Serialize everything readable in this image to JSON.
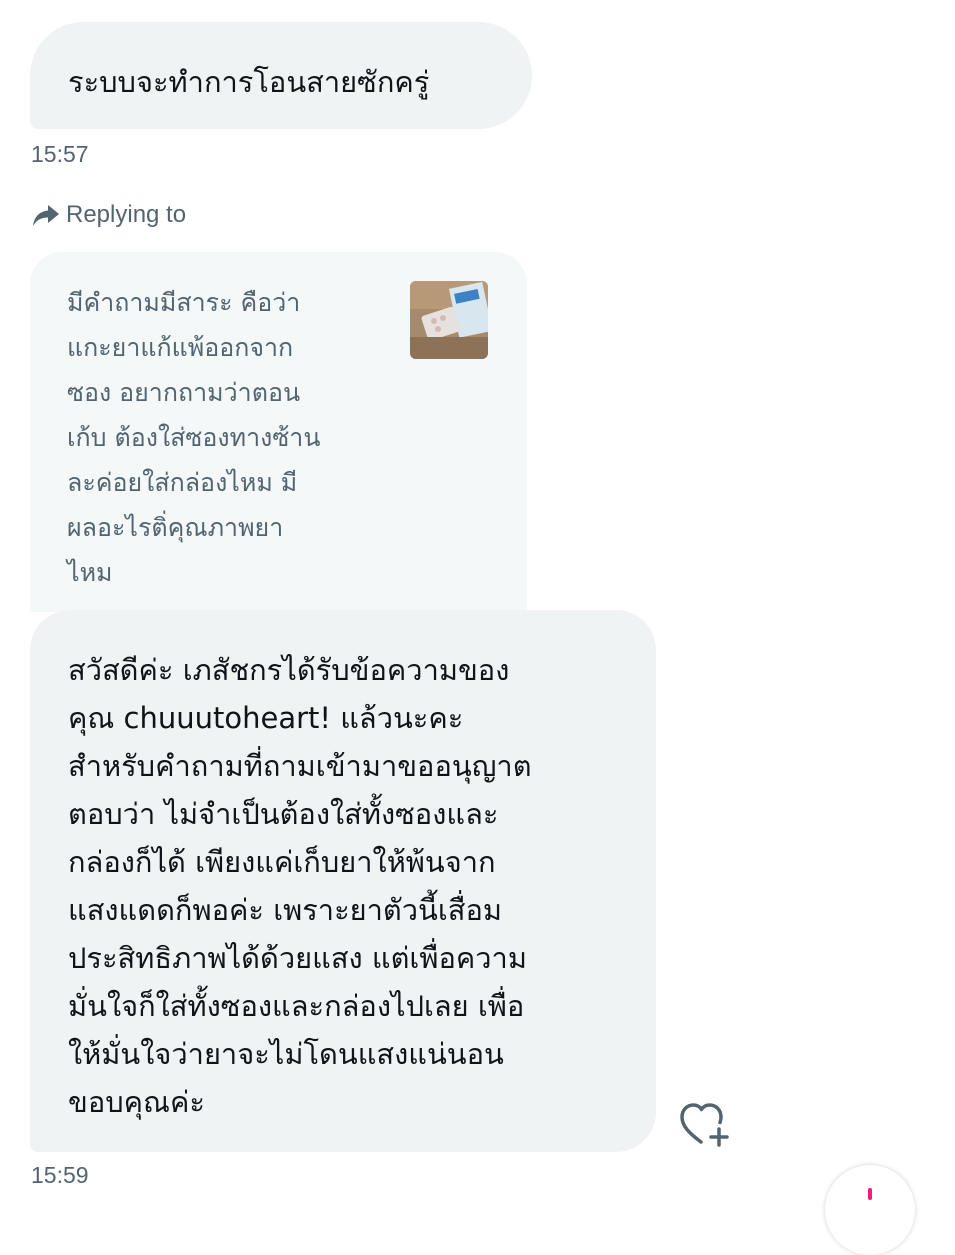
{
  "messages": [
    {
      "text": "ระบบจะทำการโอนสายซักครู่",
      "time": "15:57"
    },
    {
      "replying_label": "Replying to",
      "quote_text": "มีคำถามมีสาระ คือว่า\nแกะยาแก้แพ้ออกจาก\nซอง อยากถามว่าตอน\nเก้บ ต้องใส่ซองทางซ้าน\nละค่อยใส่กล่องไหม มี\nผลอะไรติ่คุณภาพยา\nไหม",
      "text": "สวัสดีค่ะ เภสัชกรได้รับข้อความของ\nคุณ chuuutoheart! แล้วนะคะ\nสำหรับคำถามที่ถามเข้ามาขออนุญาต\nตอบว่า ไม่จำเป็นต้องใส่ทั้งซองและ\nกล่องก็ได้ เพียงแค่เก็บยาให้พ้นจาก\nแสงแดดก็พอค่ะ เพราะยาตัวนี้เสื่อม\nประสิทธิภาพได้ด้วยแสง แต่เพื่อความ\nมั่นใจก็ใส่ทั้งซองและกล่องไปเลย เพื่อ\nให้มั่นใจว่ายาจะไม่โดนแสงแน่นอน\nขอบคุณค่ะ",
      "time": "15:59"
    }
  ],
  "icons": {
    "reply": "reply-arrow-icon",
    "react": "heart-plus-icon"
  },
  "colors": {
    "bubble": "#eff3f4",
    "meta_text": "#536471",
    "accent": "#f91880"
  }
}
